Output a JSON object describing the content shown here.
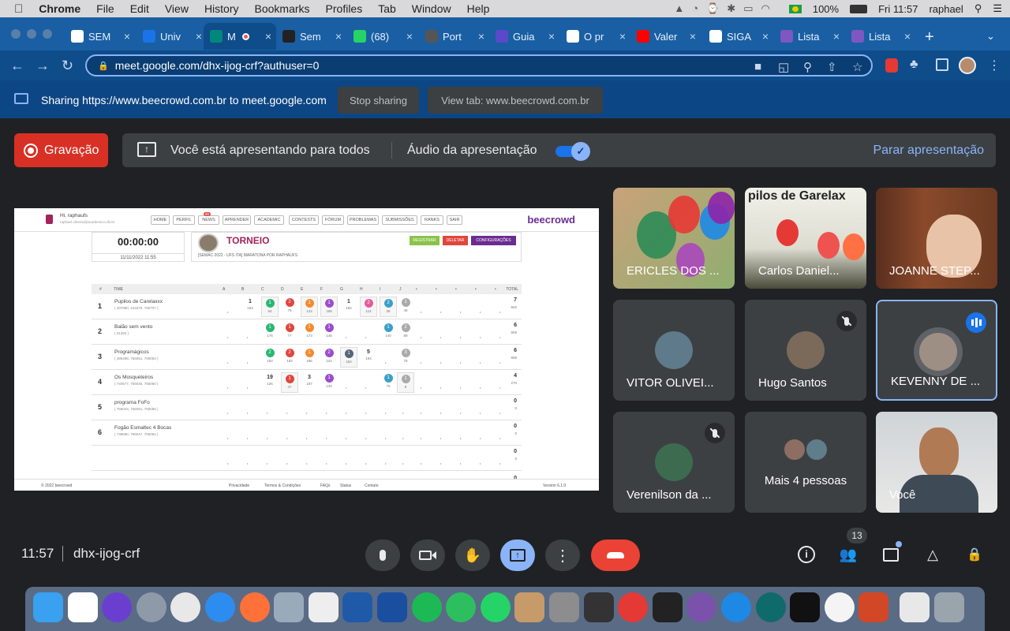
{
  "menubar": {
    "app": "Chrome",
    "items": [
      "File",
      "Edit",
      "View",
      "History",
      "Bookmarks",
      "Profiles",
      "Tab",
      "Window",
      "Help"
    ],
    "battery": "100%",
    "clock": "Fri 11:57",
    "user": "raphael"
  },
  "browser": {
    "tabs": [
      {
        "label": "SEM",
        "icon": "gmail-icon"
      },
      {
        "label": "Univ",
        "icon": "calendar-icon"
      },
      {
        "label": "M",
        "icon": "meet-icon"
      },
      {
        "label": "Sem",
        "icon": "github-icon"
      },
      {
        "label": "(68)",
        "icon": "whatsapp-icon"
      },
      {
        "label": "Port",
        "icon": "portal-icon"
      },
      {
        "label": "Guia",
        "icon": "guide-icon"
      },
      {
        "label": "O pr",
        "icon": "globe-icon"
      },
      {
        "label": "Valer",
        "icon": "youtube-icon"
      },
      {
        "label": "SIGA",
        "icon": "siga-icon"
      },
      {
        "label": "Lista",
        "icon": "list-icon"
      },
      {
        "label": "Lista",
        "icon": "list-icon"
      }
    ],
    "new_tab": "+",
    "url": "meet.google.com/dhx-ijog-crf?authuser=0"
  },
  "sharebar": {
    "text": "Sharing https://www.beecrowd.com.br to meet.google.com",
    "stop": "Stop sharing",
    "view_tab": "View tab: www.beecrowd.com.br"
  },
  "meet": {
    "record_label": "Gravação",
    "presenting_text": "Você está apresentando para todos",
    "audio_label": "Áudio da apresentação",
    "stop_presenting": "Parar apresentação",
    "time": "11:57",
    "code": "dhx-ijog-crf",
    "participants_count": "13"
  },
  "presentation": {
    "greeting": "Hi, raphaufs",
    "email": "raphael.oliveira@academico.ufs.br",
    "nav": [
      "HOME",
      "PERFIL",
      "NEWS",
      "APRENDER",
      "ACADEMIC",
      "CONTESTS",
      "FÓRUM",
      "PROBLEMAS",
      "SUBMISSÕES",
      "RANKS",
      "SAIR"
    ],
    "news_badge": "80",
    "logo": "beecrowd",
    "timer": "00:00:00",
    "date": "11/11/2022 11:55",
    "title": "TORNEIO",
    "subtitle": "[SEMAC 2022 - UFS ITA] MARATONA POR RAPHAUFS",
    "buttons": [
      "REGISTRAR",
      "DELETAR",
      "CONFIGURAÇÕES"
    ],
    "headers": [
      "#",
      "TIME",
      "A",
      "B",
      "C",
      "D",
      "E",
      "F",
      "G",
      "H",
      "I",
      "J",
      "•",
      "•",
      "•",
      "•",
      "•",
      "TOTAL"
    ],
    "rows": [
      {
        "rank": "1",
        "team": "Pupilos de Carelaxxx",
        "ids": "( 407880, 443370, 755707 )",
        "cells": [
          {
            "col": 1,
            "n": "1",
            "v": "194"
          },
          {
            "col": 2,
            "c": "1",
            "color": "#2bb673",
            "v": "54",
            "box": true
          },
          {
            "col": 3,
            "c": "2",
            "color": "#e0463d",
            "v": "76"
          },
          {
            "col": 4,
            "c": "1",
            "color": "#f28b30",
            "v": "142",
            "box": true
          },
          {
            "col": 5,
            "c": "1",
            "color": "#9c4dcc",
            "v": "165",
            "box": true
          },
          {
            "col": 6,
            "n": "1",
            "v": "194"
          },
          {
            "col": 7,
            "c": "2",
            "color": "#e85a9a",
            "v": "114",
            "box": true
          },
          {
            "col": 8,
            "c": "2",
            "color": "#3aa0c8",
            "v": "36",
            "box": true
          },
          {
            "col": 9,
            "c": "1",
            "color": "#aaaaaa",
            "v": "45"
          }
        ],
        "solved": "7",
        "penalty": "602"
      },
      {
        "rank": "2",
        "team": "Balão sem vento",
        "ids": "( 31493 )",
        "cells": [
          {
            "col": 2,
            "c": "1",
            "color": "#2bb673",
            "v": "175"
          },
          {
            "col": 3,
            "c": "1",
            "color": "#e0463d",
            "v": "77"
          },
          {
            "col": 4,
            "c": "1",
            "color": "#f28b30",
            "v": "173"
          },
          {
            "col": 5,
            "c": "1",
            "color": "#9c4dcc",
            "v": "145"
          },
          {
            "col": 8,
            "c": "1",
            "color": "#3aa0c8",
            "v": "140"
          },
          {
            "col": 9,
            "c": "2",
            "color": "#aaaaaa",
            "v": "89"
          }
        ],
        "solved": "6",
        "penalty": "809"
      },
      {
        "rank": "3",
        "team": "Programágicos",
        "ids": "( 486498, 756051, 756053 )",
        "cells": [
          {
            "col": 2,
            "c": "2",
            "color": "#2bb673",
            "v": "154"
          },
          {
            "col": 3,
            "c": "2",
            "color": "#e0463d",
            "v": "182"
          },
          {
            "col": 4,
            "c": "1",
            "color": "#f28b30",
            "v": "186"
          },
          {
            "col": 5,
            "c": "2",
            "color": "#9c4dcc",
            "v": "124"
          },
          {
            "col": 6,
            "c": "1",
            "color": "#556677",
            "v": "184",
            "box": true
          },
          {
            "col": 7,
            "n": "5",
            "v": "194"
          },
          {
            "col": 9,
            "c": "3",
            "color": "#aaaaaa",
            "v": "78"
          }
        ],
        "solved": "6",
        "penalty": "958"
      },
      {
        "rank": "4",
        "team": "Os Mosqueteiros",
        "ids": "( 740577, 756046, 756050 )",
        "cells": [
          {
            "col": 2,
            "n": "19",
            "v": "126"
          },
          {
            "col": 3,
            "c": "1",
            "color": "#e0463d",
            "v": "47",
            "box": true
          },
          {
            "col": 4,
            "n": "3",
            "v": "187"
          },
          {
            "col": 5,
            "c": "1",
            "color": "#9c4dcc",
            "v": "140"
          },
          {
            "col": 8,
            "c": "1",
            "color": "#3aa0c8",
            "v": "75"
          },
          {
            "col": 9,
            "c": "1",
            "color": "#aaaaaa",
            "v": "8",
            "box": true
          }
        ],
        "solved": "4",
        "penalty": "270"
      },
      {
        "rank": "5",
        "team": "programa FoFo",
        "ids": "( 756043, 756051, 756056 )",
        "cells": [],
        "solved": "0",
        "penalty": "0"
      },
      {
        "rank": "6",
        "team": "Fogão Esmaltec 4 Bocas",
        "ids": "( 738680, 756047, 756054 )",
        "cells": [],
        "solved": "0",
        "penalty": "0"
      },
      {
        "rank": "",
        "team": "",
        "ids": "",
        "cells": [],
        "solved": "0",
        "penalty": "0"
      }
    ],
    "last_total": "0",
    "footer_left": "© 2022 beecrowd",
    "footer_links": [
      "Privacidade",
      "Termos & Condições",
      "FAQs",
      "Status",
      "Contato"
    ],
    "version": "Version 6.1.0"
  },
  "participants": [
    {
      "name": "ERICLES DOS ...",
      "type": "video-balloons"
    },
    {
      "name": "Carlos Daniel...",
      "type": "video-banner",
      "banner": "pilos de Garelax"
    },
    {
      "name": "JOANNE STEP...",
      "type": "video-library"
    },
    {
      "name": "VITOR OLIVEI...",
      "type": "avatar"
    },
    {
      "name": "Hugo Santos",
      "type": "avatar",
      "muted": true
    },
    {
      "name": "KEVENNY DE ...",
      "type": "avatar",
      "speaking": true
    },
    {
      "name": "Verenilson da ...",
      "type": "avatar",
      "muted": true
    },
    {
      "name": "Mais 4 pessoas",
      "type": "more"
    },
    {
      "name": "Você",
      "type": "self-video"
    }
  ],
  "colors": {
    "record": "#d93025",
    "accent": "#8ab4f8",
    "hangup": "#ea4335",
    "present_active": "#8ab4f8"
  }
}
